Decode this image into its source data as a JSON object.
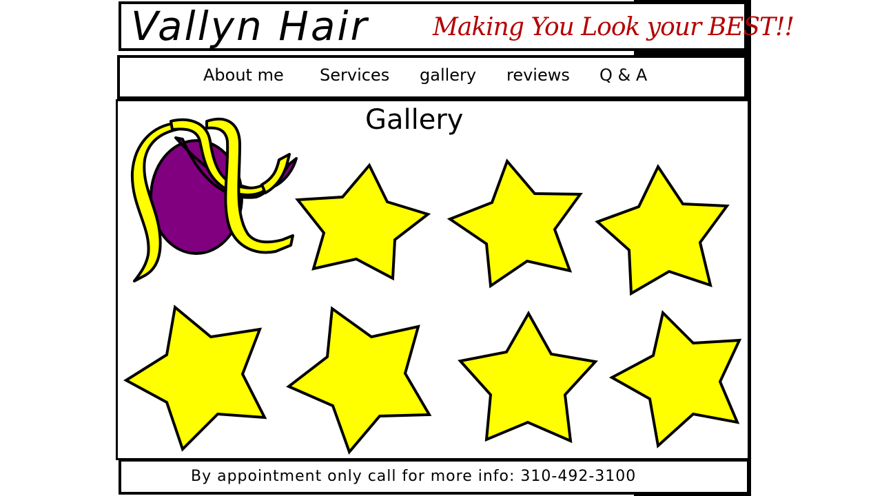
{
  "header": {
    "logo_text": "Vallyn Hair",
    "tagline": "Making You Look your BEST!!"
  },
  "nav": {
    "items": [
      {
        "label": "About me"
      },
      {
        "label": "Services"
      },
      {
        "label": "gallery"
      },
      {
        "label": "reviews"
      },
      {
        "label": "Q & A"
      }
    ]
  },
  "main": {
    "title": "Gallery",
    "gallery_items": [
      {
        "icon": "hair-bun-ribbon-icon"
      },
      {
        "icon": "star-icon"
      },
      {
        "icon": "star-icon"
      },
      {
        "icon": "star-icon"
      },
      {
        "icon": "star-icon"
      },
      {
        "icon": "star-icon"
      },
      {
        "icon": "star-icon"
      },
      {
        "icon": "star-icon"
      }
    ]
  },
  "footer": {
    "text": "By appointment only call for more info: 310-492-3100"
  },
  "colors": {
    "tagline": "#b40000",
    "star_fill": "#ffff00",
    "bun_fill": "#800080",
    "ribbon_fill": "#ffff00",
    "outline": "#000000"
  }
}
